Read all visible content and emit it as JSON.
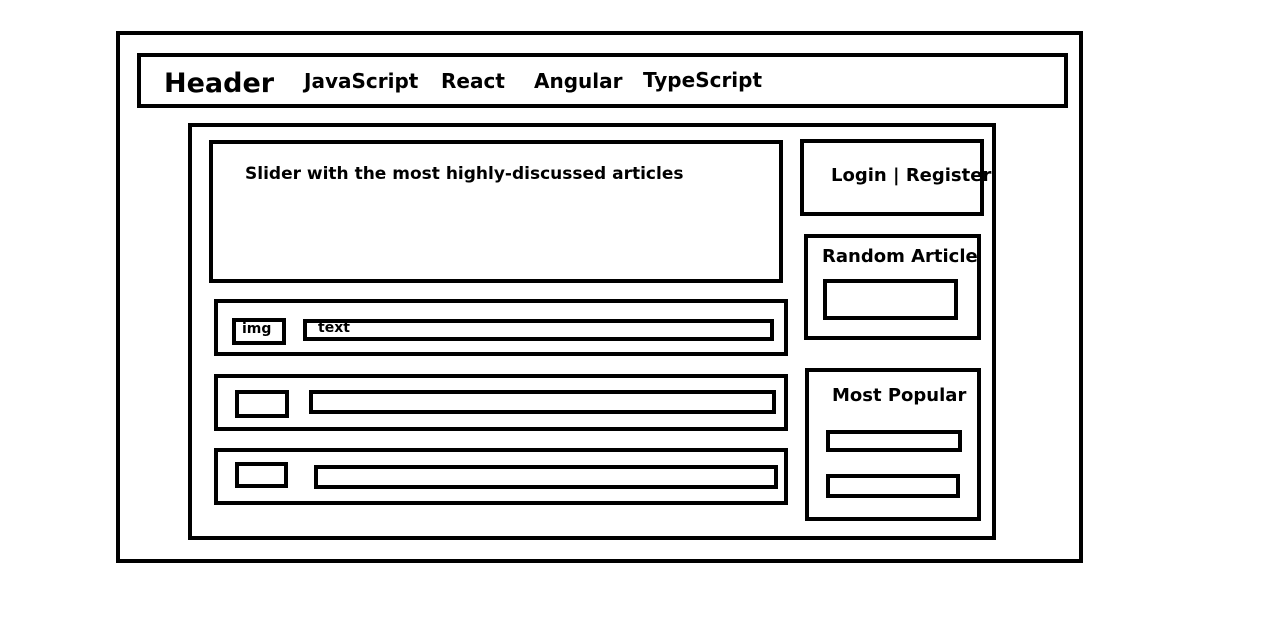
{
  "header": {
    "title": "Header",
    "nav": [
      "JavaScript",
      "React",
      "Angular",
      "TypeScript"
    ]
  },
  "slider": {
    "label": "Slider with the most highly-discussed articles"
  },
  "article_rows": {
    "first": {
      "img_label": "img",
      "text_label": "text"
    }
  },
  "auth": {
    "label": "Login | Register"
  },
  "random_article": {
    "title": "Random Article"
  },
  "most_popular": {
    "title": "Most Popular"
  }
}
